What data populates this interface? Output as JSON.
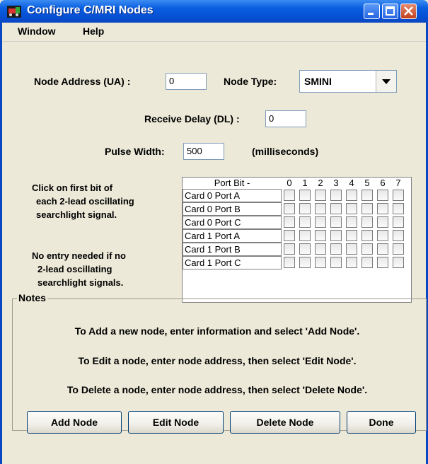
{
  "window": {
    "title": "Configure C/MRI Nodes"
  },
  "menu": [
    "Window",
    "Help"
  ],
  "form": {
    "node_address_label": "Node Address (UA) :",
    "node_address_value": "0",
    "node_type_label": "Node Type:",
    "node_type_value": "SMINI",
    "receive_delay_label": "Receive Delay (DL) :",
    "receive_delay_value": "0",
    "pulse_width_label": "Pulse Width:",
    "pulse_width_value": "500",
    "pulse_width_units": "(milliseconds)"
  },
  "instructions": {
    "lines1": [
      "Click on first bit of",
      "each 2-lead oscillating",
      "searchlight signal."
    ],
    "lines2": [
      "No entry needed if no",
      "2-lead oscillating",
      "searchlight signals."
    ]
  },
  "table": {
    "port_header": "Port  Bit -",
    "bit_headers": [
      "0",
      "1",
      "2",
      "3",
      "4",
      "5",
      "6",
      "7"
    ],
    "rows": [
      "Card 0 Port A",
      "Card 0 Port B",
      "Card 0 Port C",
      "Card 1 Port A",
      "Card 1 Port B",
      "Card 1 Port C"
    ]
  },
  "notes": {
    "title": "Notes",
    "lines": [
      "To Add a new node, enter information and select 'Add Node'.",
      "To Edit a node, enter node address, then select 'Edit Node'.",
      "To Delete a node, enter node address, then select 'Delete Node'."
    ]
  },
  "buttons": {
    "add": "Add Node",
    "edit": "Edit Node",
    "delete": "Delete Node",
    "done": "Done"
  }
}
